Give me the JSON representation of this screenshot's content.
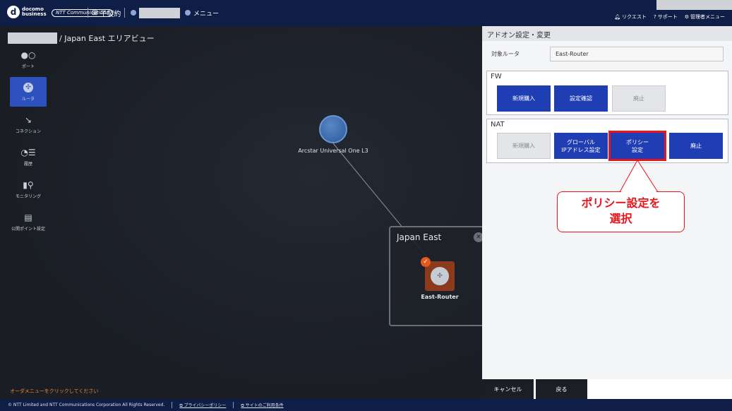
{
  "header": {
    "brand_line1": "docomo",
    "brand_line2": "business",
    "ntt_logo": "NTT Communications",
    "contract_label": "子契約",
    "menu_label": "メニュー",
    "right_links": [
      "リクエスト",
      "サポート",
      "管理者メニュー"
    ]
  },
  "canvas": {
    "breadcrumb": "/ Japan East エリアビュー",
    "sidebar": [
      {
        "label": "ポート",
        "icon": "port-icon"
      },
      {
        "label": "ルータ",
        "icon": "router-icon"
      },
      {
        "label": "コネクション",
        "icon": "connection-icon"
      },
      {
        "label": "履歴",
        "icon": "history-icon"
      },
      {
        "label": "モニタリング",
        "icon": "monitoring-icon"
      },
      {
        "label": "公開ポイント設定",
        "icon": "public-point-icon"
      }
    ],
    "cloud_label": "Arcstar Universal One L3",
    "area_title": "Japan East",
    "router_label": "East-Router",
    "order_hint": "オーダメニューをクリックしてください"
  },
  "panel": {
    "title": "アドオン設定・変更",
    "target_label": "対象ルータ",
    "target_value": "East-Router",
    "fw": {
      "title": "FW",
      "buttons": [
        "新規購入",
        "設定確認",
        "廃止"
      ]
    },
    "nat": {
      "title": "NAT",
      "buttons": [
        "新規購入",
        "グローバル\nIPアドレス設定",
        "ポリシー\n設定",
        "廃止"
      ]
    },
    "callout": "ポリシー設定を\n選択",
    "cancel_label": "キャンセル",
    "back_label": "戻る"
  },
  "footer": {
    "copyright": "© NTT Limited and NTT Communications Corporation All Rights Reserved.",
    "privacy": "プライバシーポリシー",
    "terms": "サイトのご利用条件"
  },
  "colors": {
    "primary": "#1f3eb3",
    "highlight": "#e8141d",
    "header_bg": "#0f1e46"
  }
}
